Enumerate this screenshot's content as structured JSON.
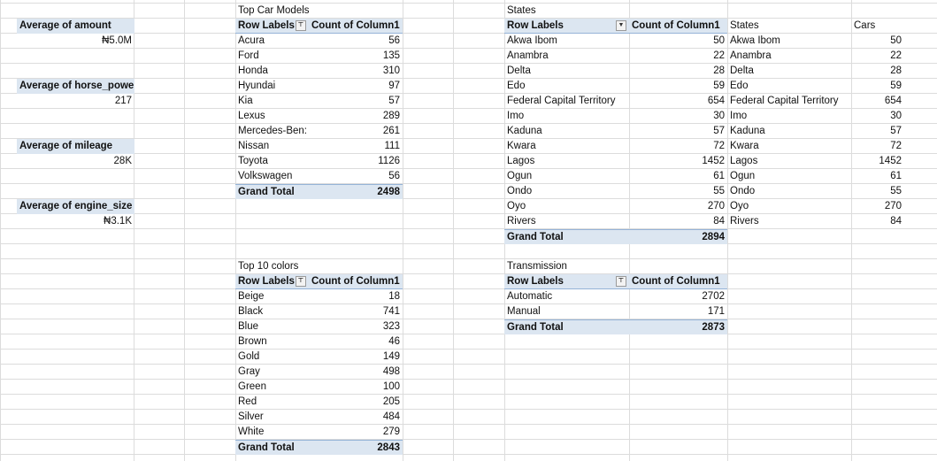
{
  "summary": {
    "amount": {
      "label": "Average of amount",
      "value": "₦5.0M"
    },
    "horse_power": {
      "label": "Average of horse_power",
      "value": "217"
    },
    "mileage": {
      "label": "Average of mileage",
      "value": "28K"
    },
    "engine_size": {
      "label": "Average of engine_size",
      "value": "₦3.1K"
    }
  },
  "car_models": {
    "title": "Top Car Models",
    "row_header": "Row Labels",
    "count_header": "Count of Column1",
    "rows": [
      {
        "label": "Acura",
        "value": "56"
      },
      {
        "label": "Ford",
        "value": "135"
      },
      {
        "label": "Honda",
        "value": "310"
      },
      {
        "label": "Hyundai",
        "value": "97"
      },
      {
        "label": "Kia",
        "value": "57"
      },
      {
        "label": "Lexus",
        "value": "289"
      },
      {
        "label": "Mercedes-Ben:",
        "value": "261"
      },
      {
        "label": "Nissan",
        "value": "111"
      },
      {
        "label": "Toyota",
        "value": "1126"
      },
      {
        "label": "Volkswagen",
        "value": "56"
      }
    ],
    "total_label": "Grand Total",
    "total_value": "2498"
  },
  "colors": {
    "title": "Top 10 colors",
    "row_header": "Row Labels",
    "count_header": "Count of Column1",
    "rows": [
      {
        "label": "Beige",
        "value": "18"
      },
      {
        "label": "Black",
        "value": "741"
      },
      {
        "label": "Blue",
        "value": "323"
      },
      {
        "label": "Brown",
        "value": "46"
      },
      {
        "label": "Gold",
        "value": "149"
      },
      {
        "label": "Gray",
        "value": "498"
      },
      {
        "label": "Green",
        "value": "100"
      },
      {
        "label": "Red",
        "value": "205"
      },
      {
        "label": "Silver",
        "value": "484"
      },
      {
        "label": "White",
        "value": "279"
      }
    ],
    "total_label": "Grand Total",
    "total_value": "2843"
  },
  "states": {
    "title": "States",
    "row_header": "Row Labels",
    "count_header": "Count of Column1",
    "rows": [
      {
        "label": "Akwa Ibom",
        "value": "50"
      },
      {
        "label": "Anambra",
        "value": "22"
      },
      {
        "label": "Delta",
        "value": "28"
      },
      {
        "label": "Edo",
        "value": "59"
      },
      {
        "label": "Federal Capital Territory",
        "value": "654"
      },
      {
        "label": "Imo",
        "value": "30"
      },
      {
        "label": "Kaduna",
        "value": "57"
      },
      {
        "label": "Kwara",
        "value": "72"
      },
      {
        "label": "Lagos",
        "value": "1452"
      },
      {
        "label": "Ogun",
        "value": "61"
      },
      {
        "label": "Ondo",
        "value": "55"
      },
      {
        "label": "Oyo",
        "value": "270"
      },
      {
        "label": "Rivers",
        "value": "84"
      }
    ],
    "total_label": "Grand Total",
    "total_value": "2894"
  },
  "states_copy": {
    "states_header": "States",
    "cars_header": "Cars",
    "rows": [
      {
        "label": "Akwa Ibom",
        "value": "50"
      },
      {
        "label": "Anambra",
        "value": "22"
      },
      {
        "label": "Delta",
        "value": "28"
      },
      {
        "label": "Edo",
        "value": "59"
      },
      {
        "label": "Federal Capital Territory",
        "value": "654"
      },
      {
        "label": "Imo",
        "value": "30"
      },
      {
        "label": "Kaduna",
        "value": "57"
      },
      {
        "label": "Kwara",
        "value": "72"
      },
      {
        "label": "Lagos",
        "value": "1452"
      },
      {
        "label": "Ogun",
        "value": "61"
      },
      {
        "label": "Ondo",
        "value": "55"
      },
      {
        "label": "Oyo",
        "value": "270"
      },
      {
        "label": "Rivers",
        "value": "84"
      }
    ]
  },
  "transmission": {
    "title": "Transmission",
    "row_header": "Row Labels",
    "count_header": "Count of Column1",
    "rows": [
      {
        "label": "Automatic",
        "value": "2702"
      },
      {
        "label": "Manual",
        "value": "171"
      }
    ],
    "total_label": "Grand Total",
    "total_value": "2873"
  },
  "icons": {
    "filter": "filter-icon",
    "dropdown": "dropdown-icon"
  },
  "colors_theme": {
    "header_fill": "#dce6f1",
    "header_border": "#95b3d7",
    "gridline": "#dcdcdc"
  }
}
